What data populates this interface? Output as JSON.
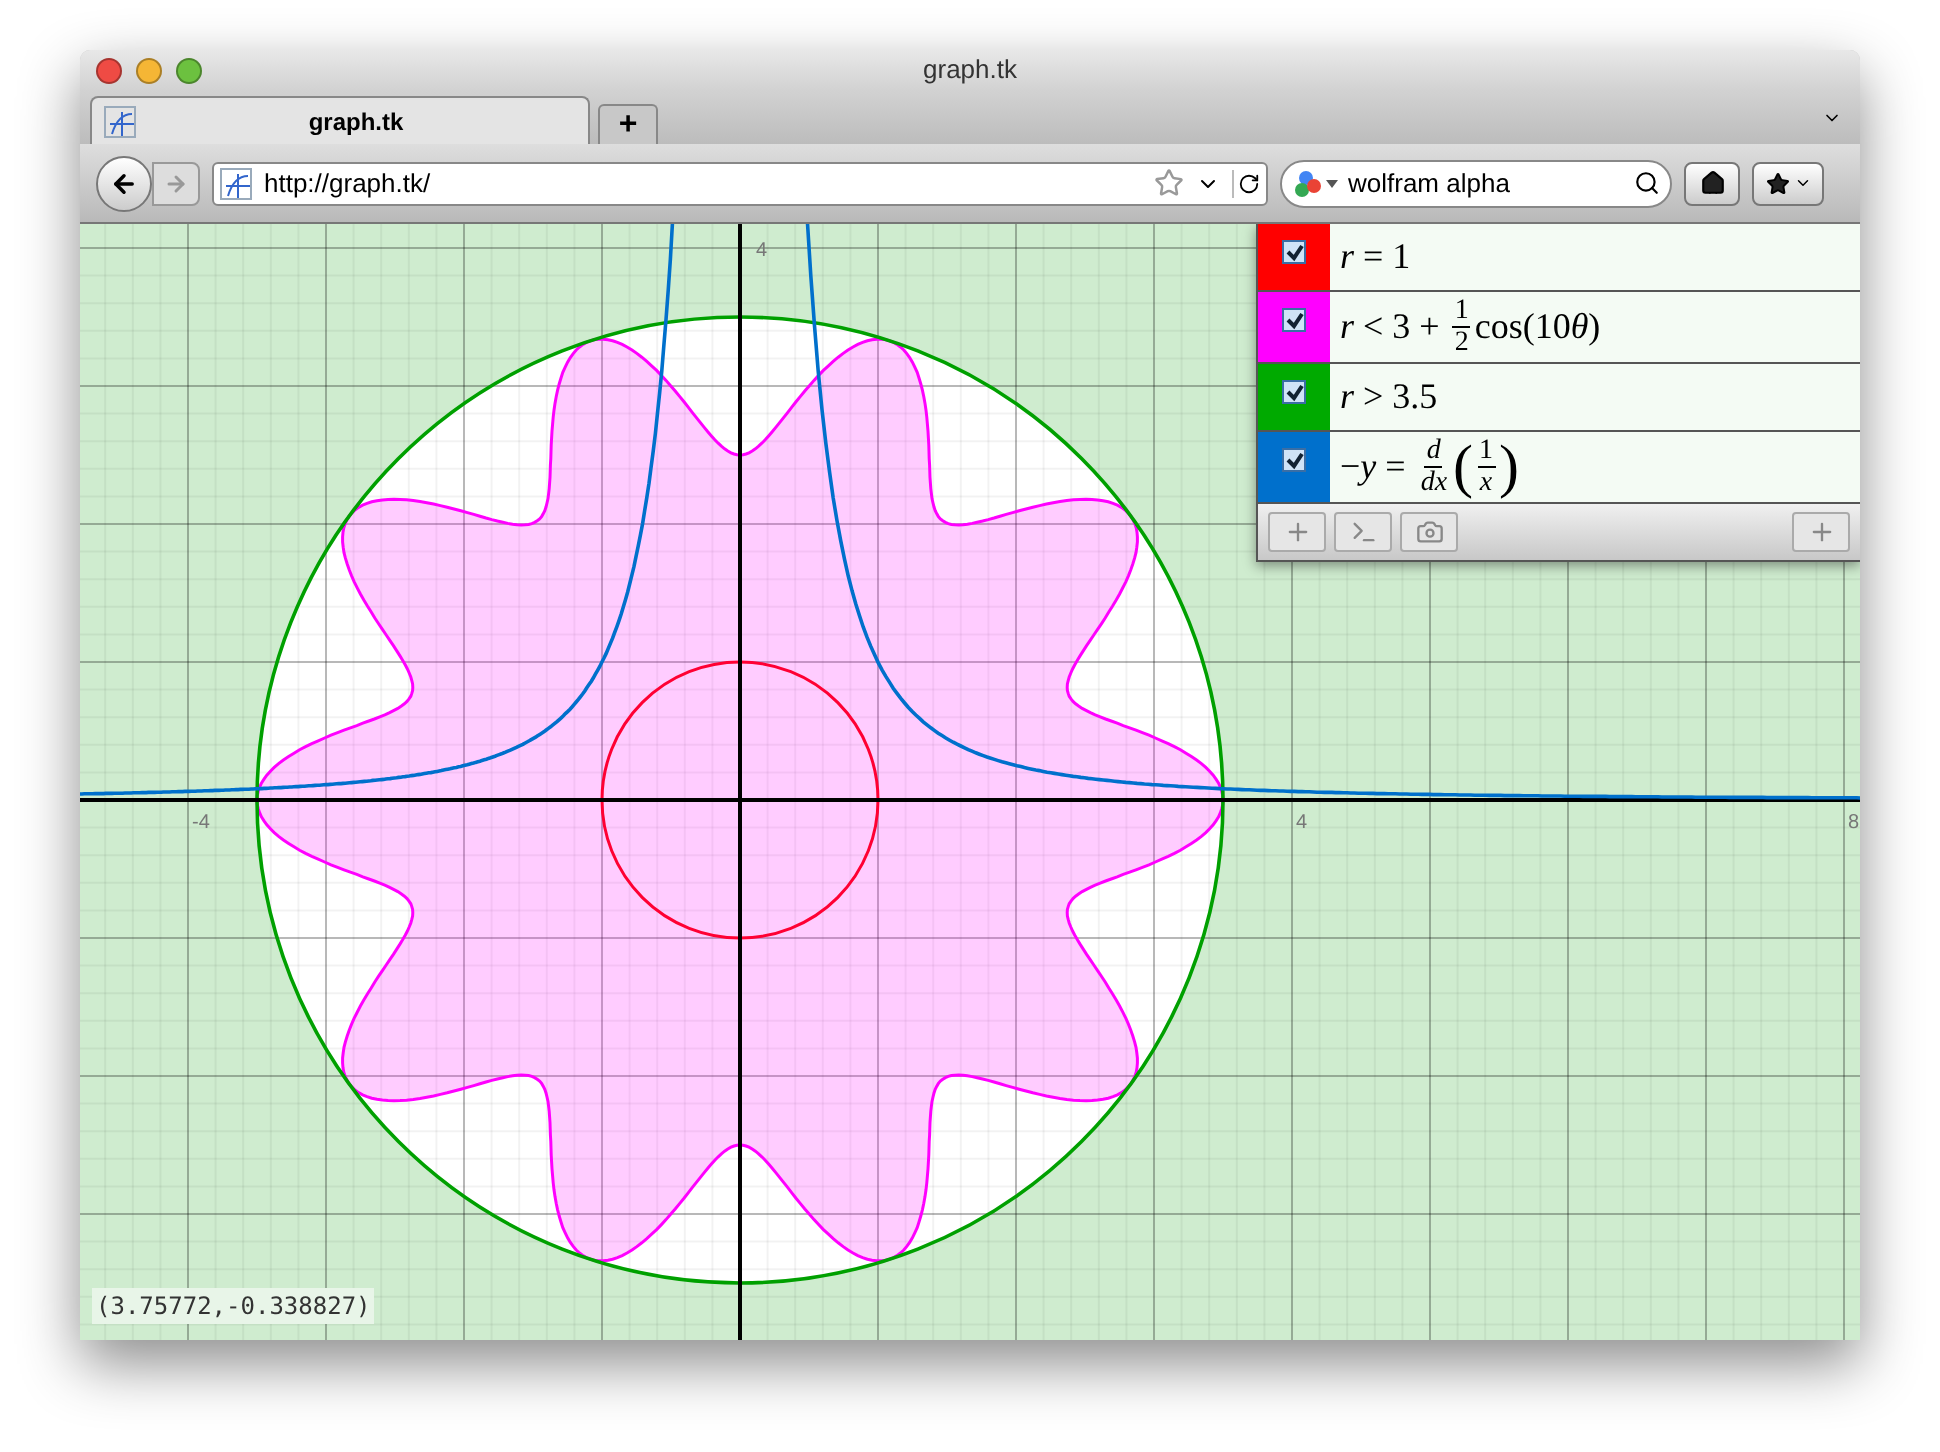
{
  "window": {
    "title": "graph.tk"
  },
  "tabs": [
    {
      "label": "graph.tk",
      "selected": true
    }
  ],
  "new_tab": "+",
  "address_bar": {
    "url": "http://graph.tk/"
  },
  "search": {
    "value": "wolfram alpha"
  },
  "graph": {
    "x_labels": [
      "-4",
      "4",
      "8"
    ],
    "y_labels": [
      "4"
    ]
  },
  "equations": [
    {
      "color": "#ff0000",
      "checked": true,
      "parts": [
        {
          "kind": "text",
          "text": "*r* = 1"
        }
      ]
    },
    {
      "color": "#ff00ff",
      "checked": true,
      "parts": [
        {
          "kind": "text",
          "text": "*r* < 3 + "
        },
        {
          "kind": "frac",
          "num": "1",
          "den": "2"
        },
        {
          "kind": "text",
          "text": "cos(10"
        },
        {
          "kind": "var",
          "text": "θ"
        },
        {
          "kind": "text",
          "text": ")"
        }
      ]
    },
    {
      "color": "#00aa00",
      "checked": true,
      "parts": [
        {
          "kind": "text",
          "text": "*r* > 3.5"
        }
      ]
    },
    {
      "color": "#0070cc",
      "checked": true,
      "parts": [
        {
          "kind": "text",
          "text": "−*y* = "
        },
        {
          "kind": "frac",
          "num": "*d*",
          "den": "*dx*"
        },
        {
          "kind": "big",
          "text": "("
        },
        {
          "kind": "frac",
          "num": "1",
          "den": "*x*"
        },
        {
          "kind": "big",
          "text": ")"
        }
      ]
    }
  ],
  "coordinates": "(3.75772,-0.338827)"
}
